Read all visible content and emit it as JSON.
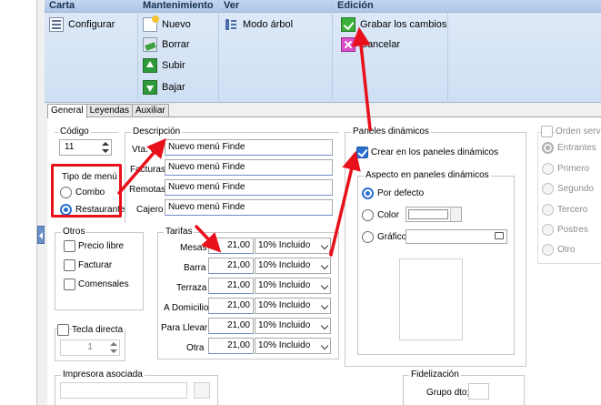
{
  "ribbon": {
    "groups": [
      {
        "title": "Carta",
        "buttons": [
          {
            "label": "Configurar",
            "icon": "config-icon"
          }
        ]
      },
      {
        "title": "Mantenimiento",
        "buttons": [
          {
            "label": "Nuevo",
            "icon": "new-icon"
          },
          {
            "label": "Borrar",
            "icon": "delete-icon"
          },
          {
            "label": "Subir",
            "icon": "arrow-up-icon"
          },
          {
            "label": "Bajar",
            "icon": "arrow-down-icon"
          }
        ]
      },
      {
        "title": "Ver",
        "buttons": [
          {
            "label": "Modo árbol",
            "icon": "tree-icon"
          }
        ]
      },
      {
        "title": "Edición",
        "buttons": [
          {
            "label": "Grabar los cambios",
            "icon": "save-check-icon"
          },
          {
            "label": "Cancelar",
            "icon": "cancel-x-icon"
          }
        ]
      }
    ]
  },
  "tabs": [
    "General",
    "Leyendas",
    "Auxiliar"
  ],
  "codigo": {
    "title": "Código",
    "value": "11"
  },
  "tipo_menu": {
    "title": "Tipo de menú",
    "options": [
      "Combo",
      "Restaurante"
    ],
    "selected": "Restaurante"
  },
  "descripcion": {
    "title": "Descripción",
    "fields": [
      {
        "label": "Vta. dir.",
        "value": "Nuevo menú Finde"
      },
      {
        "label": "Facturas",
        "value": "Nuevo menú Finde"
      },
      {
        "label": "Remotas",
        "value": "Nuevo menú Finde"
      },
      {
        "label": "Cajero",
        "value": "Nuevo menú Finde"
      }
    ]
  },
  "otros": {
    "title": "Otros",
    "options": [
      "Precio libre",
      "Facturar",
      "Comensales"
    ]
  },
  "tecla_directa": {
    "title": "Tecla directa",
    "value": "1"
  },
  "tarifas": {
    "title": "Tarifas",
    "rows": [
      {
        "label": "Mesas",
        "price": "21,00",
        "tax": "10% Incluido"
      },
      {
        "label": "Barra",
        "price": "21,00",
        "tax": "10% Incluido"
      },
      {
        "label": "Terraza",
        "price": "21,00",
        "tax": "10% Incluido"
      },
      {
        "label": "A Domicilio",
        "price": "21,00",
        "tax": "10% Incluido"
      },
      {
        "label": "Para Llevar",
        "price": "21,00",
        "tax": "10% Incluido"
      },
      {
        "label": "Otra",
        "price": "21,00",
        "tax": "10% Incluido"
      }
    ]
  },
  "paneles": {
    "title": "Paneles dinámicos",
    "crear_label": "Crear en los paneles dinámicos",
    "aspecto_title": "Aspecto en paneles dinámicos",
    "options": [
      "Por defecto",
      "Color",
      "Gráfico"
    ],
    "selected": "Por defecto"
  },
  "orden": {
    "title": "Orden servicio",
    "options": [
      "Entrantes",
      "Primero",
      "Segundo",
      "Tercero",
      "Postres",
      "Otro"
    ],
    "selected": "Entrantes"
  },
  "impresora": {
    "title": "Impresora asociada",
    "value": ""
  },
  "fidelizacion": {
    "title": "Fidelización",
    "grupo_label": "Grupo dto;",
    "value": ""
  },
  "colors": {
    "ribbon_bg": "#cfdff3",
    "accent": "#2a6fd1",
    "annotation_red": "#e8101a"
  }
}
